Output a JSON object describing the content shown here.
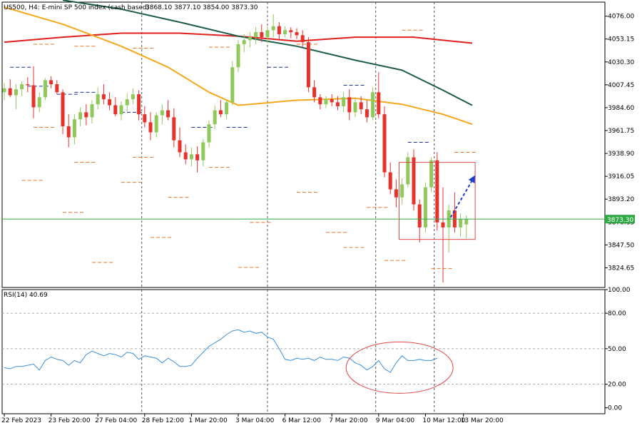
{
  "header": {
    "symbol": "US500, H4:  E-mini SP 500 index (cash based)",
    "ohlc": "3868.10 3877.10 3854.00 3873.30"
  },
  "colors": {
    "bull": "#90c95a",
    "bear": "#e8312b",
    "ma_red": "#e0201c",
    "ma_green": "#1c5a4a",
    "ma_orange": "#f5a81e",
    "price_line": "#2eaa44",
    "rsi_line": "#3a8fd8",
    "highlight": "#e04848",
    "arrow": "#1e3fcc",
    "level_dash": "#e87722",
    "level_blue": "#1f2fa0"
  },
  "chart_data": [
    {
      "type": "candlestick",
      "title": "US500, H4:  E-mini SP 500 index (cash based)",
      "ylim": [
        3805,
        4090
      ],
      "yticks": [
        "4076.00",
        "4053.15",
        "4030.30",
        "4007.45",
        "3984.60",
        "3961.75",
        "3938.90",
        "3916.05",
        "3893.20",
        "3870.35",
        "3847.50",
        "3824.65"
      ],
      "current_price": "3873.30",
      "x_labels": [
        "22 Feb 2023",
        "23 Feb 20:00",
        "27 Feb 04:00",
        "28 Feb 12:00",
        "1 Mar 20:00",
        "3 Mar 04:00",
        "6 Mar 12:00",
        "7 Mar 20:00",
        "9 Mar 04:00",
        "10 Mar 12:00",
        "13 Mar 20:00"
      ],
      "separators": [
        3,
        8,
        15
      ],
      "candles": [
        [
          4000,
          4009,
          3992,
          4004
        ],
        [
          4004,
          4013,
          3995,
          3997
        ],
        [
          3997,
          4008,
          3983,
          4003
        ],
        [
          4003,
          4011,
          3996,
          4008
        ],
        [
          4008,
          4015,
          4000,
          4007
        ],
        [
          4007,
          4026,
          3974,
          3985
        ],
        [
          3985,
          4000,
          3980,
          3995
        ],
        [
          3995,
          4014,
          3992,
          4012
        ],
        [
          4012,
          4016,
          4004,
          4008
        ],
        [
          4008,
          4012,
          3998,
          4000
        ],
        [
          4000,
          4003,
          3958,
          3966
        ],
        [
          3966,
          3978,
          3945,
          3955
        ],
        [
          3955,
          3978,
          3948,
          3973
        ],
        [
          3973,
          3985,
          3966,
          3980
        ],
        [
          3980,
          3988,
          3967,
          3975
        ],
        [
          3975,
          3992,
          3969,
          3988
        ],
        [
          3988,
          4005,
          3983,
          3998
        ],
        [
          3998,
          4008,
          3988,
          3993
        ],
        [
          3993,
          4000,
          3982,
          3987
        ],
        [
          3987,
          3995,
          3976,
          3978
        ],
        [
          3978,
          3991,
          3972,
          3987
        ],
        [
          3987,
          3999,
          3981,
          3993
        ],
        [
          3993,
          4004,
          3988,
          3998
        ],
        [
          3998,
          4002,
          3972,
          3978
        ],
        [
          3978,
          3986,
          3965,
          3970
        ],
        [
          3970,
          3980,
          3952,
          3960
        ],
        [
          3960,
          3980,
          3955,
          3977
        ],
        [
          3977,
          3988,
          3968,
          3982
        ],
        [
          3982,
          3992,
          3972,
          3975
        ],
        [
          3975,
          3984,
          3945,
          3952
        ],
        [
          3952,
          3965,
          3935,
          3940
        ],
        [
          3940,
          3948,
          3928,
          3933
        ],
        [
          3933,
          3945,
          3926,
          3938
        ],
        [
          3938,
          3946,
          3920,
          3932
        ],
        [
          3932,
          3953,
          3926,
          3950
        ],
        [
          3950,
          3972,
          3945,
          3968
        ],
        [
          3968,
          3987,
          3963,
          3982
        ],
        [
          3982,
          3992,
          3975,
          3978
        ],
        [
          3978,
          3993,
          3973,
          3990
        ],
        [
          3990,
          4031,
          3987,
          4025
        ],
        [
          4025,
          4052,
          4020,
          4048
        ],
        [
          4048,
          4058,
          4040,
          4052
        ],
        [
          4052,
          4060,
          4045,
          4055
        ],
        [
          4055,
          4065,
          4048,
          4060
        ],
        [
          4060,
          4068,
          4050,
          4055
        ],
        [
          4055,
          4066,
          4049,
          4062
        ],
        [
          4062,
          4078,
          4055,
          4066
        ],
        [
          4066,
          4070,
          4052,
          4058
        ],
        [
          4058,
          4066,
          4055,
          4062
        ],
        [
          4062,
          4065,
          4054,
          4060
        ],
        [
          4060,
          4064,
          4053,
          4057
        ],
        [
          4057,
          4062,
          4045,
          4050
        ],
        [
          4050,
          4055,
          4000,
          4005
        ],
        [
          4005,
          4012,
          3990,
          3995
        ],
        [
          3995,
          3998,
          3983,
          3988
        ],
        [
          3988,
          3996,
          3984,
          3993
        ],
        [
          3993,
          3998,
          3986,
          3990
        ],
        [
          3990,
          3996,
          3982,
          3986
        ],
        [
          3986,
          4000,
          3980,
          3995
        ],
        [
          3995,
          4003,
          3972,
          3980
        ],
        [
          3980,
          3995,
          3975,
          3990
        ],
        [
          3990,
          3996,
          3978,
          3983
        ],
        [
          3983,
          3992,
          3970,
          3975
        ],
        [
          3975,
          4005,
          3972,
          4000
        ],
        [
          4000,
          4020,
          3974,
          3978
        ],
        [
          3978,
          3986,
          3915,
          3920
        ],
        [
          3920,
          3930,
          3898,
          3903
        ],
        [
          3903,
          3913,
          3885,
          3895
        ],
        [
          3895,
          3914,
          3888,
          3908
        ],
        [
          3908,
          3940,
          3905,
          3935
        ],
        [
          3935,
          3943,
          3882,
          3888
        ],
        [
          3888,
          3893,
          3850,
          3865
        ],
        [
          3865,
          3910,
          3860,
          3905
        ],
        [
          3905,
          3935,
          3900,
          3932
        ],
        [
          3932,
          3940,
          3862,
          3870
        ],
        [
          3870,
          3905,
          3810,
          3865
        ],
        [
          3865,
          3888,
          3840,
          3882
        ],
        [
          3882,
          3900,
          3860,
          3865
        ],
        [
          3865,
          3879,
          3856,
          3873
        ],
        [
          3868,
          3877,
          3854,
          3873
        ]
      ],
      "moving_averages": [
        {
          "name": "red",
          "color": "#e0201c",
          "points": [
            [
              0,
              4050
            ],
            [
              10,
              4055
            ],
            [
              20,
              4059
            ],
            [
              30,
              4059
            ],
            [
              40,
              4056
            ],
            [
              50,
              4051
            ],
            [
              60,
              4055
            ],
            [
              70,
              4055
            ],
            [
              80,
              4049
            ]
          ]
        },
        {
          "name": "green",
          "color": "#1c5a4a",
          "points": [
            [
              10,
              4092
            ],
            [
              20,
              4083
            ],
            [
              30,
              4070
            ],
            [
              40,
              4056
            ],
            [
              50,
              4046
            ],
            [
              60,
              4032
            ],
            [
              68,
              4022
            ],
            [
              75,
              4002
            ],
            [
              80,
              3987
            ]
          ]
        },
        {
          "name": "orange",
          "color": "#f5a81e",
          "points": [
            [
              0,
              4085
            ],
            [
              10,
              4068
            ],
            [
              20,
              4046
            ],
            [
              28,
              4025
            ],
            [
              35,
              4000
            ],
            [
              40,
              3987
            ],
            [
              50,
              3992
            ],
            [
              60,
              3994
            ],
            [
              68,
              3988
            ],
            [
              75,
              3978
            ],
            [
              80,
              3968
            ]
          ]
        }
      ],
      "level_marks": [
        [
          5,
          4048,
          "o"
        ],
        [
          12,
          4046,
          "o"
        ],
        [
          22,
          4044,
          "o"
        ],
        [
          35,
          4045,
          "o"
        ],
        [
          50,
          4048,
          "o"
        ],
        [
          68,
          4062,
          "o"
        ],
        [
          5,
          3965,
          "o"
        ],
        [
          12,
          3930,
          "o"
        ],
        [
          22,
          3935,
          "o"
        ],
        [
          35,
          3925,
          "o"
        ],
        [
          50,
          3900,
          "o"
        ],
        [
          62,
          3885,
          "o"
        ],
        [
          3,
          3912,
          "o"
        ],
        [
          10,
          3880,
          "o"
        ],
        [
          20,
          3910,
          "o"
        ],
        [
          28,
          3895,
          "o"
        ],
        [
          42,
          3870,
          "o"
        ],
        [
          55,
          3860,
          "o"
        ],
        [
          15,
          3830,
          "o"
        ],
        [
          25,
          3855,
          "o"
        ],
        [
          40,
          3825,
          "o"
        ],
        [
          58,
          3845,
          "o"
        ],
        [
          65,
          3832,
          "o"
        ],
        [
          73,
          3824,
          "o"
        ],
        [
          77,
          3940,
          "o"
        ],
        [
          4,
          4006,
          "b"
        ],
        [
          12,
          4000,
          "b"
        ],
        [
          20,
          3980,
          "b"
        ],
        [
          32,
          3965,
          "b"
        ],
        [
          38,
          3965,
          "b"
        ],
        [
          45,
          4025,
          "b"
        ],
        [
          58,
          4007,
          "b"
        ],
        [
          69,
          3950,
          "b"
        ],
        [
          1,
          4025,
          "b"
        ],
        [
          9,
          3998,
          "b"
        ]
      ],
      "highlight_box": {
        "i0": 67.5,
        "i1": 80.5,
        "y0": 3930,
        "y1": 3853
      },
      "arrow": {
        "from": [
          76.3,
          3875
        ],
        "to": [
          80.5,
          3917
        ]
      }
    },
    {
      "type": "line",
      "title": "RSI(14) 40.69",
      "ylim": [
        -5,
        100
      ],
      "yticks": [
        "100.00",
        "80.00",
        "50.00",
        "20.00",
        "0.00"
      ],
      "levels": [
        80,
        50,
        20
      ],
      "values": [
        34,
        33,
        35,
        35,
        36,
        37,
        32,
        40,
        43,
        41,
        40,
        36,
        40,
        38,
        45,
        48,
        46,
        44,
        46,
        45,
        43,
        47,
        46,
        41,
        44,
        43,
        42,
        38,
        42,
        39,
        35,
        35,
        36,
        42,
        47,
        52,
        55,
        58,
        62,
        65,
        66,
        64,
        65,
        63,
        64,
        60,
        58,
        50,
        41,
        40,
        42,
        41,
        42,
        40,
        43,
        41,
        41,
        40,
        43,
        42,
        38,
        36,
        32,
        35,
        40,
        33,
        30,
        38,
        44,
        40,
        40,
        41,
        40,
        40,
        42
      ]
    }
  ]
}
